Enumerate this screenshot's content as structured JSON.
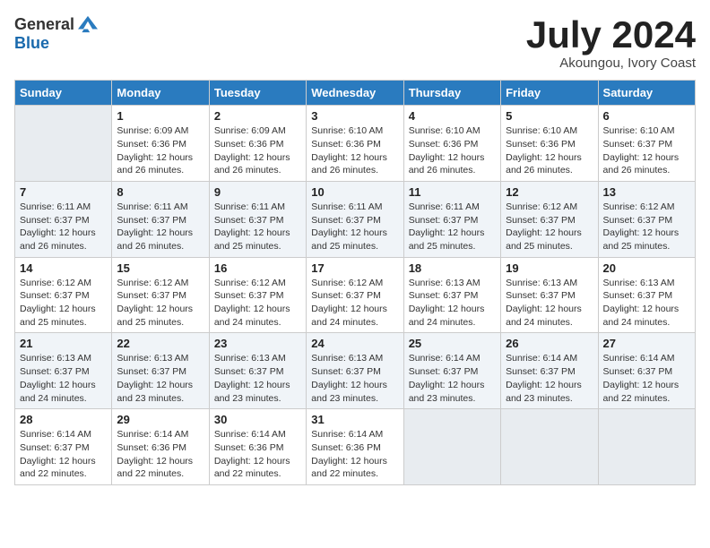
{
  "logo": {
    "general": "General",
    "blue": "Blue"
  },
  "header": {
    "month": "July 2024",
    "location": "Akoungou, Ivory Coast"
  },
  "weekdays": [
    "Sunday",
    "Monday",
    "Tuesday",
    "Wednesday",
    "Thursday",
    "Friday",
    "Saturday"
  ],
  "weeks": [
    [
      {
        "day": "",
        "sunrise": "",
        "sunset": "",
        "daylight": ""
      },
      {
        "day": "1",
        "sunrise": "Sunrise: 6:09 AM",
        "sunset": "Sunset: 6:36 PM",
        "daylight": "Daylight: 12 hours and 26 minutes."
      },
      {
        "day": "2",
        "sunrise": "Sunrise: 6:09 AM",
        "sunset": "Sunset: 6:36 PM",
        "daylight": "Daylight: 12 hours and 26 minutes."
      },
      {
        "day": "3",
        "sunrise": "Sunrise: 6:10 AM",
        "sunset": "Sunset: 6:36 PM",
        "daylight": "Daylight: 12 hours and 26 minutes."
      },
      {
        "day": "4",
        "sunrise": "Sunrise: 6:10 AM",
        "sunset": "Sunset: 6:36 PM",
        "daylight": "Daylight: 12 hours and 26 minutes."
      },
      {
        "day": "5",
        "sunrise": "Sunrise: 6:10 AM",
        "sunset": "Sunset: 6:36 PM",
        "daylight": "Daylight: 12 hours and 26 minutes."
      },
      {
        "day": "6",
        "sunrise": "Sunrise: 6:10 AM",
        "sunset": "Sunset: 6:37 PM",
        "daylight": "Daylight: 12 hours and 26 minutes."
      }
    ],
    [
      {
        "day": "7",
        "sunrise": "Sunrise: 6:11 AM",
        "sunset": "Sunset: 6:37 PM",
        "daylight": "Daylight: 12 hours and 26 minutes."
      },
      {
        "day": "8",
        "sunrise": "Sunrise: 6:11 AM",
        "sunset": "Sunset: 6:37 PM",
        "daylight": "Daylight: 12 hours and 26 minutes."
      },
      {
        "day": "9",
        "sunrise": "Sunrise: 6:11 AM",
        "sunset": "Sunset: 6:37 PM",
        "daylight": "Daylight: 12 hours and 25 minutes."
      },
      {
        "day": "10",
        "sunrise": "Sunrise: 6:11 AM",
        "sunset": "Sunset: 6:37 PM",
        "daylight": "Daylight: 12 hours and 25 minutes."
      },
      {
        "day": "11",
        "sunrise": "Sunrise: 6:11 AM",
        "sunset": "Sunset: 6:37 PM",
        "daylight": "Daylight: 12 hours and 25 minutes."
      },
      {
        "day": "12",
        "sunrise": "Sunrise: 6:12 AM",
        "sunset": "Sunset: 6:37 PM",
        "daylight": "Daylight: 12 hours and 25 minutes."
      },
      {
        "day": "13",
        "sunrise": "Sunrise: 6:12 AM",
        "sunset": "Sunset: 6:37 PM",
        "daylight": "Daylight: 12 hours and 25 minutes."
      }
    ],
    [
      {
        "day": "14",
        "sunrise": "Sunrise: 6:12 AM",
        "sunset": "Sunset: 6:37 PM",
        "daylight": "Daylight: 12 hours and 25 minutes."
      },
      {
        "day": "15",
        "sunrise": "Sunrise: 6:12 AM",
        "sunset": "Sunset: 6:37 PM",
        "daylight": "Daylight: 12 hours and 25 minutes."
      },
      {
        "day": "16",
        "sunrise": "Sunrise: 6:12 AM",
        "sunset": "Sunset: 6:37 PM",
        "daylight": "Daylight: 12 hours and 24 minutes."
      },
      {
        "day": "17",
        "sunrise": "Sunrise: 6:12 AM",
        "sunset": "Sunset: 6:37 PM",
        "daylight": "Daylight: 12 hours and 24 minutes."
      },
      {
        "day": "18",
        "sunrise": "Sunrise: 6:13 AM",
        "sunset": "Sunset: 6:37 PM",
        "daylight": "Daylight: 12 hours and 24 minutes."
      },
      {
        "day": "19",
        "sunrise": "Sunrise: 6:13 AM",
        "sunset": "Sunset: 6:37 PM",
        "daylight": "Daylight: 12 hours and 24 minutes."
      },
      {
        "day": "20",
        "sunrise": "Sunrise: 6:13 AM",
        "sunset": "Sunset: 6:37 PM",
        "daylight": "Daylight: 12 hours and 24 minutes."
      }
    ],
    [
      {
        "day": "21",
        "sunrise": "Sunrise: 6:13 AM",
        "sunset": "Sunset: 6:37 PM",
        "daylight": "Daylight: 12 hours and 24 minutes."
      },
      {
        "day": "22",
        "sunrise": "Sunrise: 6:13 AM",
        "sunset": "Sunset: 6:37 PM",
        "daylight": "Daylight: 12 hours and 23 minutes."
      },
      {
        "day": "23",
        "sunrise": "Sunrise: 6:13 AM",
        "sunset": "Sunset: 6:37 PM",
        "daylight": "Daylight: 12 hours and 23 minutes."
      },
      {
        "day": "24",
        "sunrise": "Sunrise: 6:13 AM",
        "sunset": "Sunset: 6:37 PM",
        "daylight": "Daylight: 12 hours and 23 minutes."
      },
      {
        "day": "25",
        "sunrise": "Sunrise: 6:14 AM",
        "sunset": "Sunset: 6:37 PM",
        "daylight": "Daylight: 12 hours and 23 minutes."
      },
      {
        "day": "26",
        "sunrise": "Sunrise: 6:14 AM",
        "sunset": "Sunset: 6:37 PM",
        "daylight": "Daylight: 12 hours and 23 minutes."
      },
      {
        "day": "27",
        "sunrise": "Sunrise: 6:14 AM",
        "sunset": "Sunset: 6:37 PM",
        "daylight": "Daylight: 12 hours and 22 minutes."
      }
    ],
    [
      {
        "day": "28",
        "sunrise": "Sunrise: 6:14 AM",
        "sunset": "Sunset: 6:37 PM",
        "daylight": "Daylight: 12 hours and 22 minutes."
      },
      {
        "day": "29",
        "sunrise": "Sunrise: 6:14 AM",
        "sunset": "Sunset: 6:36 PM",
        "daylight": "Daylight: 12 hours and 22 minutes."
      },
      {
        "day": "30",
        "sunrise": "Sunrise: 6:14 AM",
        "sunset": "Sunset: 6:36 PM",
        "daylight": "Daylight: 12 hours and 22 minutes."
      },
      {
        "day": "31",
        "sunrise": "Sunrise: 6:14 AM",
        "sunset": "Sunset: 6:36 PM",
        "daylight": "Daylight: 12 hours and 22 minutes."
      },
      {
        "day": "",
        "sunrise": "",
        "sunset": "",
        "daylight": ""
      },
      {
        "day": "",
        "sunrise": "",
        "sunset": "",
        "daylight": ""
      },
      {
        "day": "",
        "sunrise": "",
        "sunset": "",
        "daylight": ""
      }
    ]
  ]
}
